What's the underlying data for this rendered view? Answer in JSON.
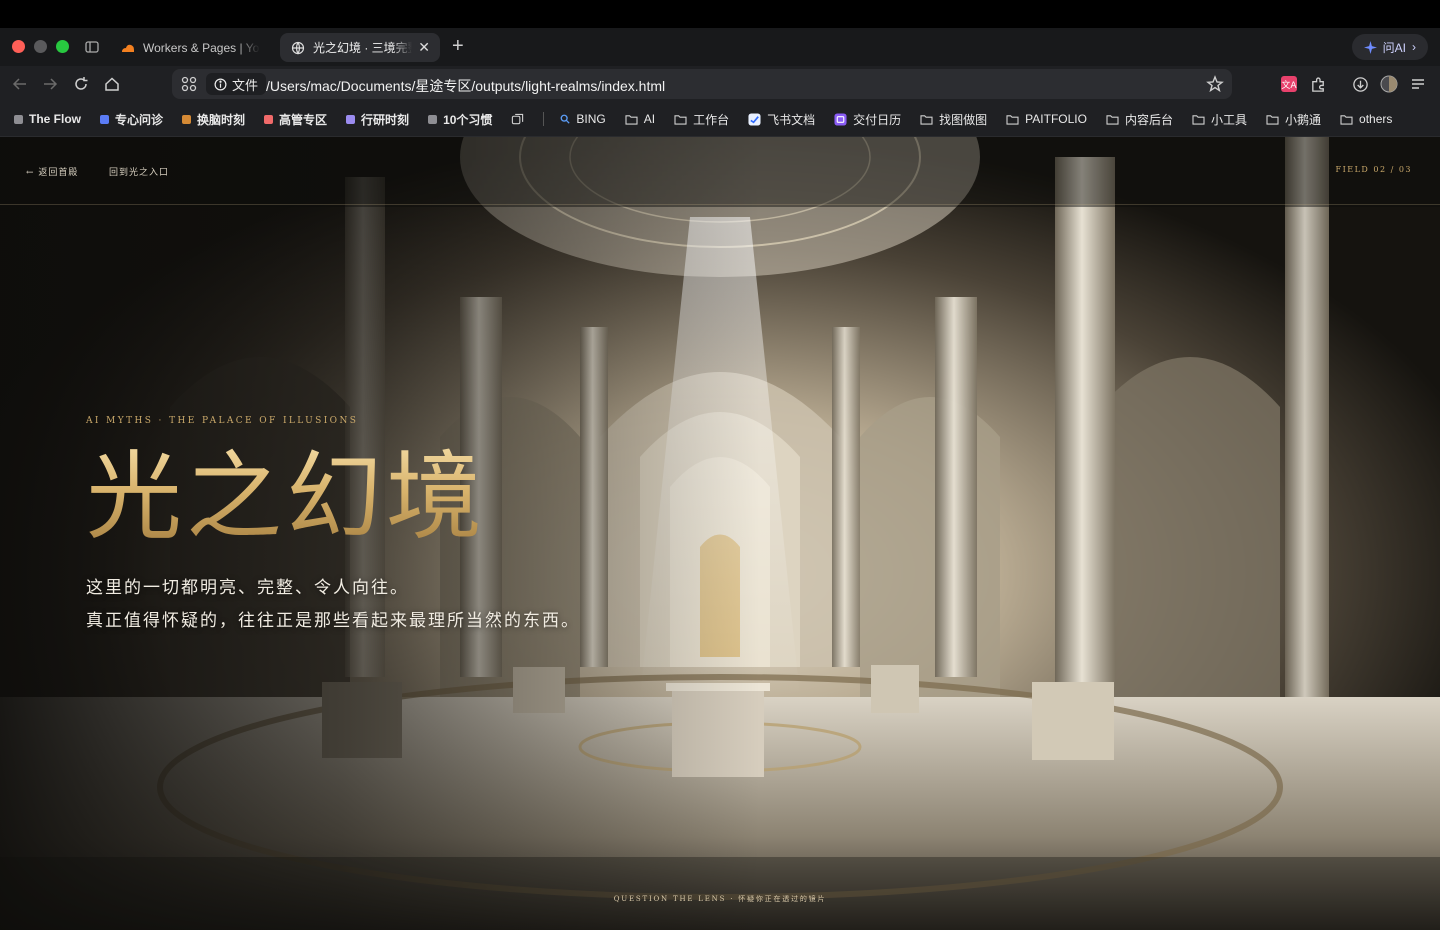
{
  "browser": {
    "tabs": [
      {
        "title": "Workers & Pages | York",
        "active": false,
        "favicon": "cloudflare-icon"
      },
      {
        "title": "光之幻境 · 三境完整",
        "active": true,
        "favicon": "globe-icon"
      }
    ],
    "ask_ai_label": "问AI",
    "url_chip_label": "文件",
    "url": "/Users/mac/Documents/星途专区/outputs/light-realms/index.html",
    "bookmarks": [
      {
        "label": "The Flow",
        "color": "#8e8e93",
        "type": "group"
      },
      {
        "label": "专心问诊",
        "color": "#5b7cf5",
        "type": "group"
      },
      {
        "label": "换脑时刻",
        "color": "#d58a35",
        "type": "group"
      },
      {
        "label": "高管专区",
        "color": "#f06a6a",
        "type": "group"
      },
      {
        "label": "行研时刻",
        "color": "#9b8cf0",
        "type": "group"
      },
      {
        "label": "10个习惯",
        "color": "#8e8e93",
        "type": "group"
      },
      {
        "label": "BING",
        "type": "link"
      },
      {
        "label": "AI",
        "type": "folder"
      },
      {
        "label": "工作台",
        "type": "folder"
      },
      {
        "label": "飞书文档",
        "type": "link"
      },
      {
        "label": "交付日历",
        "type": "link"
      },
      {
        "label": "找图做图",
        "type": "folder"
      },
      {
        "label": "PAITFOLIO",
        "type": "folder"
      },
      {
        "label": "内容后台",
        "type": "folder"
      },
      {
        "label": "小工具",
        "type": "folder"
      },
      {
        "label": "小鹅通",
        "type": "folder"
      },
      {
        "label": "others",
        "type": "folder"
      }
    ]
  },
  "page": {
    "back_label": "← 返回首殿",
    "entrance_label": "回到光之入口",
    "field_counter": "FIELD 02 / 03",
    "eyebrow": "AI MYTHS · THE PALACE OF ILLUSIONS",
    "title": "光之幻境",
    "subtitle_line1": "这里的一切都明亮、完整、令人向往。",
    "subtitle_line2": "真正值得怀疑的，往往正是那些看起来最理所当然的东西。",
    "bottom_caption": "QUESTION THE LENS · 怀疑你正在透过的镜片",
    "accent_color": "#c9a86a"
  }
}
